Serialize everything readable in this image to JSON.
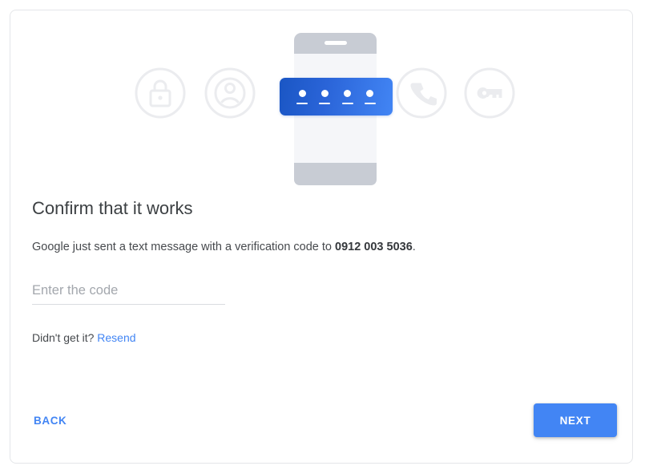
{
  "illustration": {
    "icons": [
      {
        "name": "lock-icon",
        "label": "Lock"
      },
      {
        "name": "person-icon",
        "label": "Account"
      },
      {
        "name": "phone-icon",
        "label": "Phone call"
      },
      {
        "name": "key-icon",
        "label": "Key"
      }
    ],
    "code_banner": {
      "slots": 4,
      "name": "verification-code-banner"
    },
    "colors": {
      "banner_gradient_start": "#1a56c4",
      "banner_gradient_end": "#4285f4",
      "icon_outline": "#ebecef",
      "phone_body": "#c8ccd4",
      "phone_screen": "#f5f6f9"
    }
  },
  "main": {
    "heading": "Confirm that it works",
    "subtext_before": "Google just sent a text message with a verification code to ",
    "phone_number": "0912 003 5036",
    "subtext_after": ".",
    "code_input": {
      "placeholder": "Enter the code",
      "value": ""
    },
    "resend_prompt": "Didn't get it?",
    "resend_link": "Resend"
  },
  "footer": {
    "back_label": "BACK",
    "next_label": "NEXT",
    "accent_color": "#4285f4"
  }
}
